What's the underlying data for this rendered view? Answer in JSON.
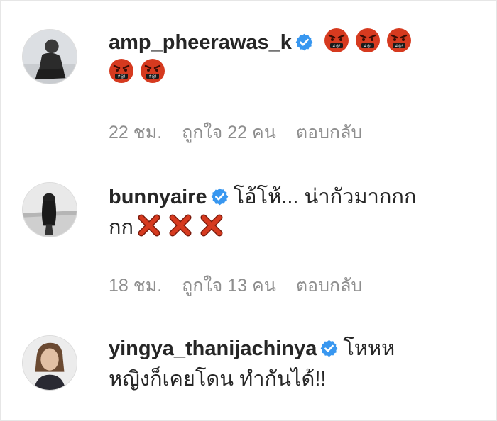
{
  "comments": [
    {
      "username": "amp_pheerawas_k",
      "verified": true,
      "text": "",
      "emoji_count": 5,
      "emoji_name": "cursing-face-icon",
      "time": "22 ชม.",
      "likes": "ถูกใจ 22 คน",
      "reply": "ตอบกลับ"
    },
    {
      "username": "bunnyaire",
      "verified": true,
      "text_line1": "โอ้โห้... น่ากัวมากกก",
      "text_line2": "กก",
      "emoji_count": 3,
      "emoji_name": "cross-mark-icon",
      "time": "18 ชม.",
      "likes": "ถูกใจ 13 คน",
      "reply": "ตอบกลับ"
    },
    {
      "username": "yingya_thanijachinya",
      "verified": true,
      "text_line1": "โหหห",
      "text_line2": "หญิงก็เคยโดน ทำกันได้!!"
    }
  ],
  "colors": {
    "username": "#262626",
    "meta": "#8e8e8e",
    "verified_badge": "#3897f0",
    "cursing_face": "#d63a1f",
    "cross_mark": "#d63a1f"
  }
}
